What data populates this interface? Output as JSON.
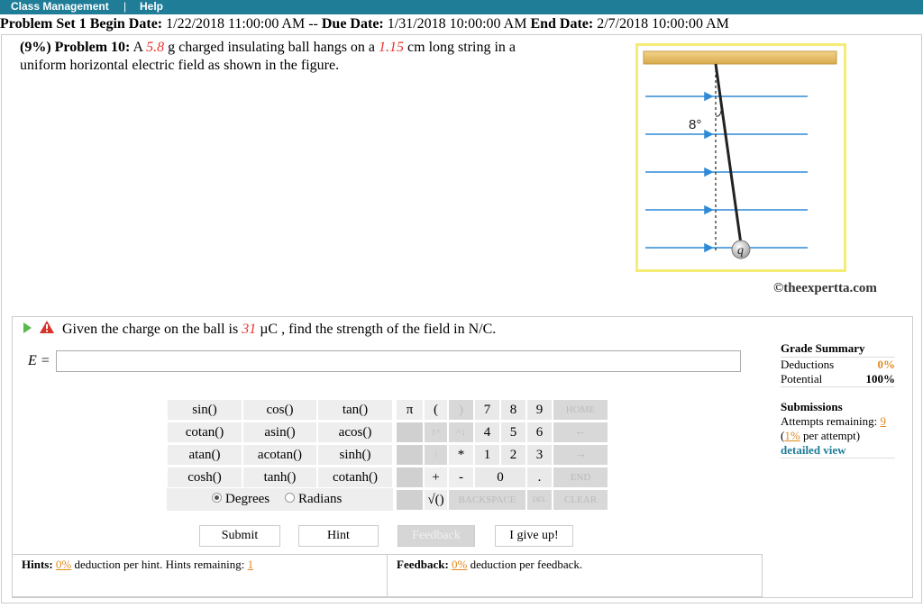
{
  "topbar": {
    "class_management": "Class Management",
    "separator": "|",
    "help": "Help"
  },
  "dates": {
    "set_label": "Problem Set 1 Begin Date:",
    "begin": "1/22/2018 11:00:00 AM --",
    "due_label": "Due Date:",
    "due": "1/31/2018 10:00:00 AM",
    "end_label": "End Date:",
    "end": "2/7/2018 10:00:00 AM"
  },
  "problem": {
    "heading": "(9%) Problem 10:",
    "t1": " A ",
    "mass": "5.8",
    "t2": " g charged insulating ball hangs on a ",
    "length": "1.15",
    "t3": " cm long string in a uniform horizontal electric field as shown in the figure."
  },
  "figure": {
    "angle_label": "8°",
    "charge_label": "q",
    "credit": "©theexpertta.com"
  },
  "question": {
    "t1": "Given the charge on the ball is ",
    "charge": "31",
    "t2": " µC , find the strength of the field in N/C.",
    "answer_label": "E =",
    "answer_value": ""
  },
  "grade_summary": {
    "title": "Grade Summary",
    "deductions_label": "Deductions",
    "deductions_value": "0%",
    "potential_label": "Potential",
    "potential_value": "100%"
  },
  "submissions": {
    "title": "Submissions",
    "attempts_label": "Attempts remaining: ",
    "attempts_value": "9",
    "per_attempt_pct": "1%",
    "per_attempt_text": " per attempt)",
    "detailed_view": "detailed view"
  },
  "calculator": {
    "functions": [
      [
        "sin()",
        "cos()",
        "tan()"
      ],
      [
        "cotan()",
        "asin()",
        "acos()"
      ],
      [
        "atan()",
        "acotan()",
        "sinh()"
      ],
      [
        "cosh()",
        "tanh()",
        "cotanh()"
      ]
    ],
    "degrees": "Degrees",
    "radians": "Radians",
    "pi": "π",
    "lparen": "(",
    "rparen": ")",
    "up_arrows": "↑^",
    "down_arrows": "^↓",
    "slash": "/",
    "star": "*",
    "plus": "+",
    "minus": "-",
    "sqrt": "√()",
    "digits": [
      "7",
      "8",
      "9",
      "4",
      "5",
      "6",
      "1",
      "2",
      "3",
      "0",
      "."
    ],
    "home": "HOME",
    "left": "←",
    "right": "→",
    "end": "END",
    "backspace": "BACKSPACE",
    "del": "DEL",
    "clear": "CLEAR"
  },
  "actions": {
    "submit": "Submit",
    "hint": "Hint",
    "feedback": "Feedback",
    "give_up": "I give up!"
  },
  "hints": {
    "label": "Hints:",
    "pct": "0%",
    "text": " deduction per hint. Hints remaining: ",
    "remaining": "1"
  },
  "feedback": {
    "label": "Feedback:",
    "pct": "0%",
    "text": " deduction per feedback."
  }
}
